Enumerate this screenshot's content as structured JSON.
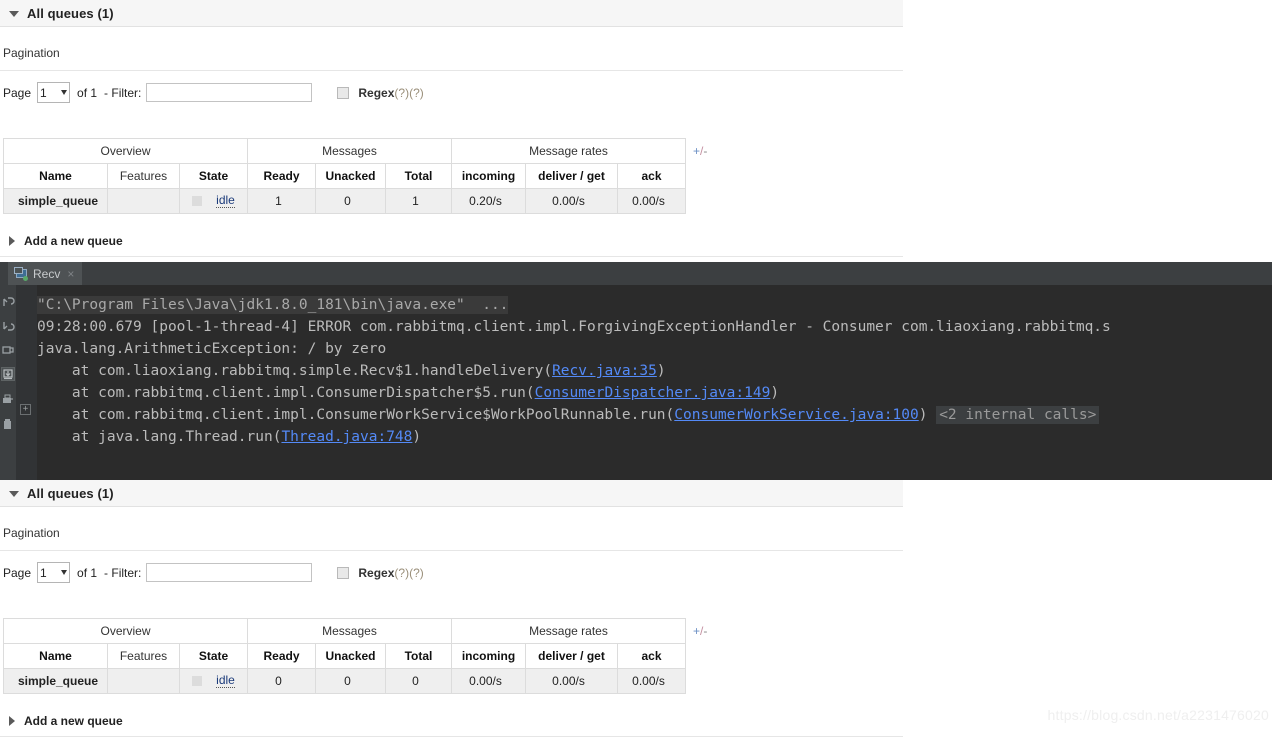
{
  "watermark": "https://blog.csdn.net/a2231476020",
  "sections": [
    {
      "header_title": "All queues (1)",
      "pagination_label": "Pagination",
      "pager": {
        "page_label": "Page",
        "page_value": "1",
        "of_label": "of 1",
        "filter_label": "- Filter:",
        "filter_value": "",
        "regex_label": "Regex",
        "regex_hint": "(?)(?)",
        "regex_checked": false
      },
      "table": {
        "group_headers": [
          "Overview",
          "Messages",
          "Message rates"
        ],
        "columns": [
          "Name",
          "Features",
          "State",
          "Ready",
          "Unacked",
          "Total",
          "incoming",
          "deliver / get",
          "ack"
        ],
        "toggle_label": "+/-",
        "rows": [
          {
            "name": "simple_queue",
            "features": "",
            "state": "idle",
            "ready": "1",
            "unacked": "0",
            "total": "1",
            "incoming": "0.20/s",
            "deliver_get": "0.00/s",
            "ack": "0.00/s"
          }
        ]
      },
      "add_queue_label": "Add a new queue"
    },
    {
      "header_title": "All queues (1)",
      "pagination_label": "Pagination",
      "pager": {
        "page_label": "Page",
        "page_value": "1",
        "of_label": "of 1",
        "filter_label": "- Filter:",
        "filter_value": "",
        "regex_label": "Regex",
        "regex_hint": "(?)(?)",
        "regex_checked": false
      },
      "table": {
        "group_headers": [
          "Overview",
          "Messages",
          "Message rates"
        ],
        "columns": [
          "Name",
          "Features",
          "State",
          "Ready",
          "Unacked",
          "Total",
          "incoming",
          "deliver / get",
          "ack"
        ],
        "toggle_label": "+/-",
        "rows": [
          {
            "name": "simple_queue",
            "features": "",
            "state": "idle",
            "ready": "0",
            "unacked": "0",
            "total": "0",
            "incoming": "0.00/s",
            "deliver_get": "0.00/s",
            "ack": "0.00/s"
          }
        ]
      },
      "add_queue_label": "Add a new queue"
    }
  ],
  "console": {
    "tab_label": "Recv",
    "tab_close": "×",
    "fold_marker": "+",
    "lines": {
      "command": "\"C:\\Program Files\\Java\\jdk1.8.0_181\\bin\\java.exe\"  ...",
      "error_header": "09:28:00.679 [pool-1-thread-4] ERROR com.rabbitmq.client.impl.ForgivingExceptionHandler - Consumer com.liaoxiang.rabbitmq.s",
      "exception": "java.lang.ArithmeticException: / by zero",
      "frame1_pre": "    at com.liaoxiang.rabbitmq.simple.Recv$1.handleDelivery(",
      "frame1_link": "Recv.java:35",
      "frame1_post": ")",
      "frame2_pre": "    at com.rabbitmq.client.impl.ConsumerDispatcher$5.run(",
      "frame2_link": "ConsumerDispatcher.java:149",
      "frame2_post": ")",
      "frame3_pre": "    at com.rabbitmq.client.impl.ConsumerWorkService$WorkPoolRunnable.run(",
      "frame3_link": "ConsumerWorkService.java:100",
      "frame3_post": ")",
      "frame3_internal": "<2 internal calls>",
      "frame4_pre": "    at java.lang.Thread.run(",
      "frame4_link": "Thread.java:748",
      "frame4_post": ")"
    },
    "toolbar_icons": [
      "rerun-icon",
      "stop-icon",
      "restart-icon",
      "scroll-to-end-icon",
      "print-icon",
      "trash-icon"
    ]
  }
}
